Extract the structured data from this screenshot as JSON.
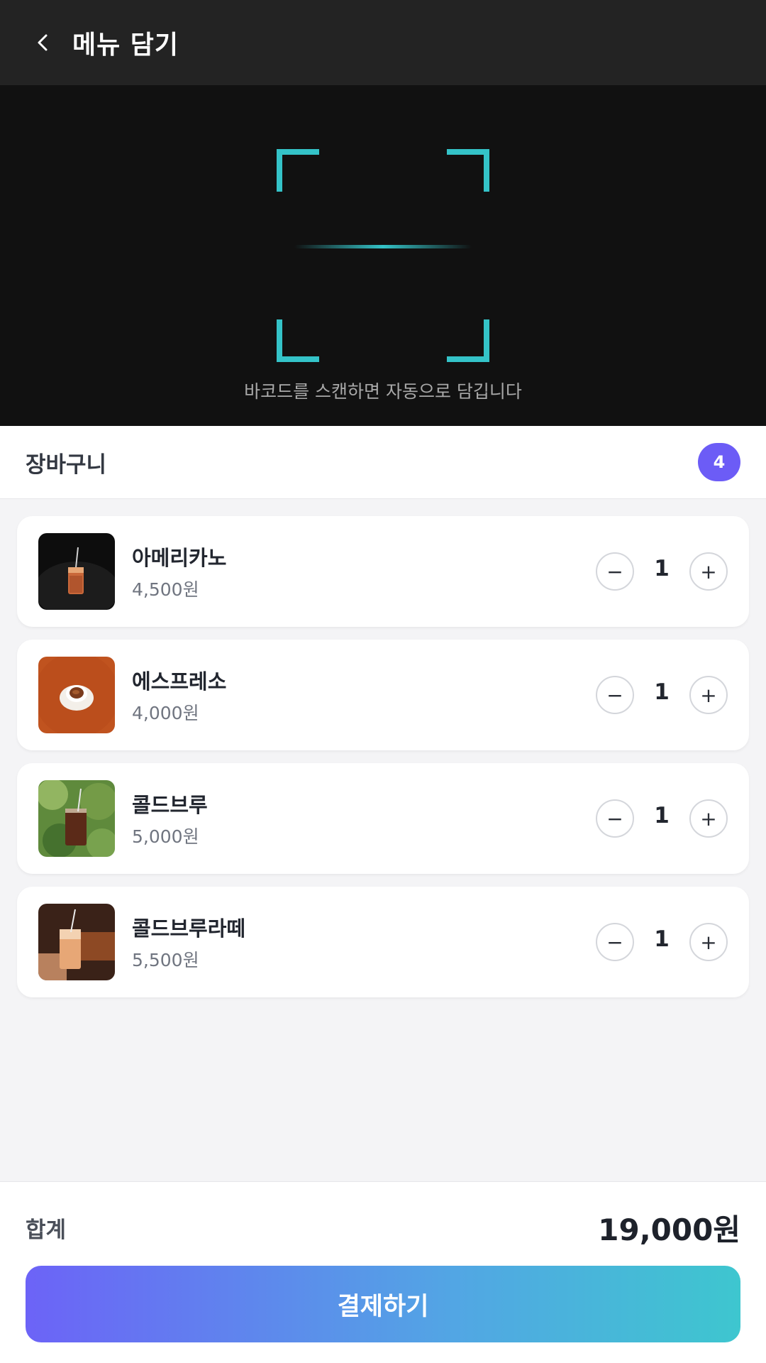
{
  "header": {
    "title": "메뉴 담기",
    "back_icon": "chevron-left-icon"
  },
  "scanner": {
    "hint": "바코드를 스캔하면 자동으로 담깁니다",
    "accent": "#34c3c8"
  },
  "cart": {
    "title": "장바구니",
    "count": "4",
    "badge_color": "#6c5cf6"
  },
  "items": [
    {
      "name": "아메리카노",
      "price": "4,500원",
      "qty": "1",
      "minus": "−",
      "plus": "+"
    },
    {
      "name": "에스프레소",
      "price": "4,000원",
      "qty": "1",
      "minus": "−",
      "plus": "+"
    },
    {
      "name": "콜드브루",
      "price": "5,000원",
      "qty": "1",
      "minus": "−",
      "plus": "+"
    },
    {
      "name": "콜드브루라떼",
      "price": "5,500원",
      "qty": "1",
      "minus": "−",
      "plus": "+"
    }
  ],
  "footer": {
    "total_label": "합계",
    "total_value": "19,000원",
    "pay_label": "결제하기"
  }
}
